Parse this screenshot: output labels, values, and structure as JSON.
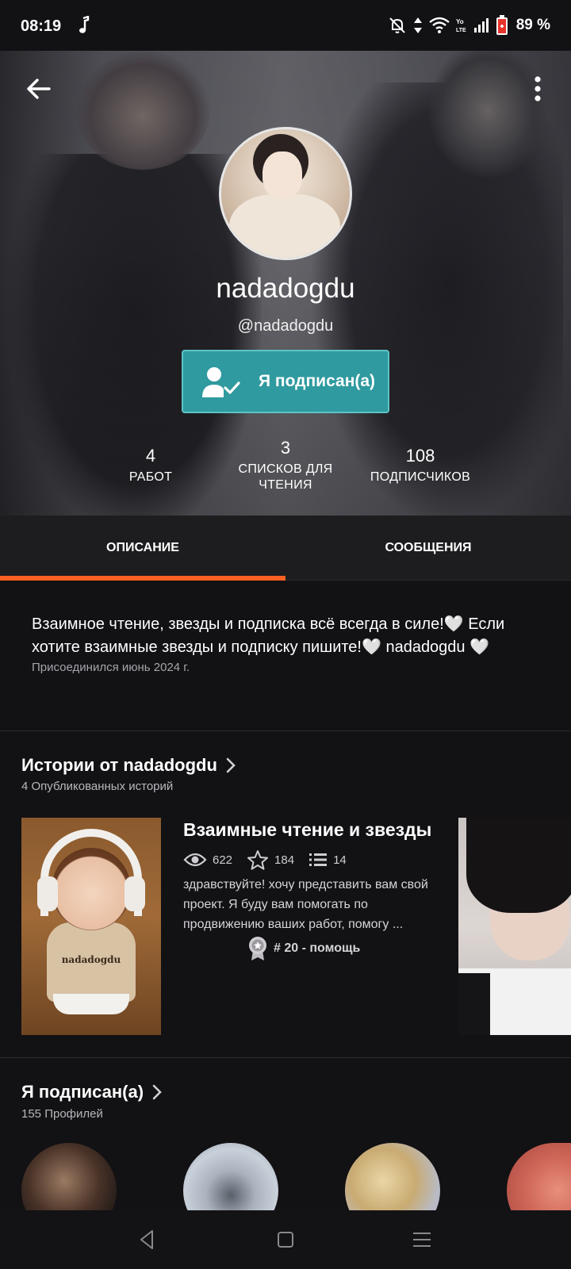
{
  "status_bar": {
    "time": "08:19",
    "battery": "89 %",
    "icons": [
      "music-note-icon",
      "mute-icon",
      "data-arrows-icon",
      "wifi-icon",
      "volte-icon",
      "signal-icon",
      "battery-icon"
    ]
  },
  "profile": {
    "display_name": "nadadogdu",
    "username": "@nadadogdu",
    "follow_button_label": "Я подписан(а)",
    "stats": [
      {
        "value": "4",
        "label": "РАБОТ"
      },
      {
        "value": "3",
        "label_line1": "СПИСКОВ ДЛЯ",
        "label_line2": "ЧТЕНИЯ"
      },
      {
        "value": "108",
        "label": "ПОДПИСЧИКОВ"
      }
    ]
  },
  "tabs": [
    {
      "label": "ОПИСАНИЕ",
      "active": true
    },
    {
      "label": "СООБЩЕНИЯ",
      "active": false
    }
  ],
  "about": {
    "text": "Взаимное чтение, звезды и подписка всё всегда в силе!🤍 Если хотите взаимные звезды и подписку пишите!🤍 nadadogdu 🤍",
    "joined": "Присоединился июнь 2024 г."
  },
  "stories_section": {
    "title": "Истории от nadadogdu",
    "subtitle": "4 Опубликованных историй",
    "story": {
      "cover_text": "nadadogdu",
      "title": "Взаимные чтение и звезды",
      "reads": "622",
      "votes": "184",
      "parts": "14",
      "description": "здравствуйте! хочу представить вам свой проект. Я буду вам помогать по продвижению ваших работ, помогу ...",
      "rank": "# 20 - помощь"
    }
  },
  "following_section": {
    "title": "Я подписан(а)",
    "subtitle": "155 Профилей"
  },
  "colors": {
    "accent_orange": "#ff6122",
    "follow_teal": "#2f9a9f",
    "background": "#121114"
  }
}
